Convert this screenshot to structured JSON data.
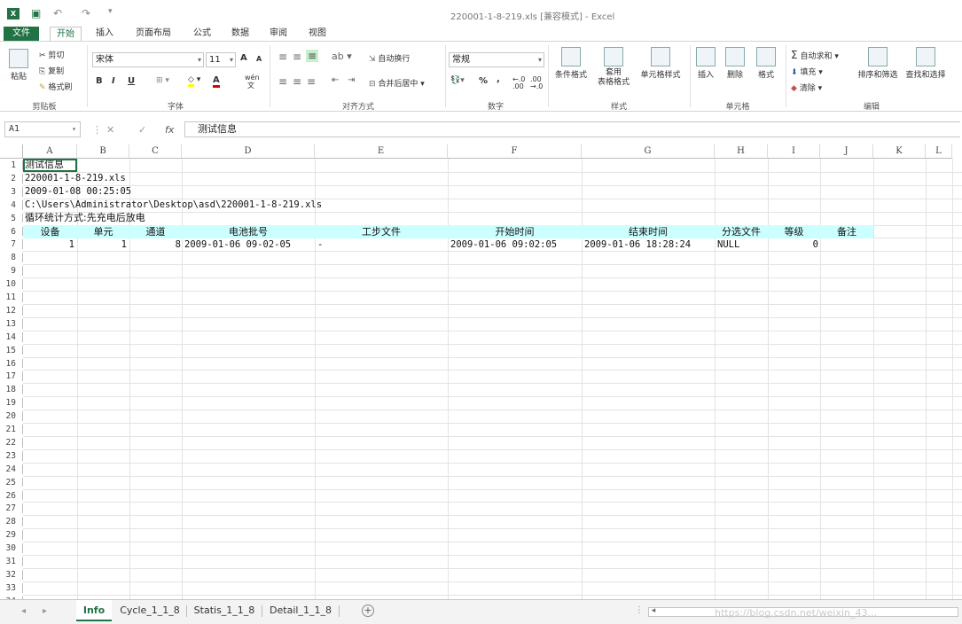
{
  "app": {
    "window_title": "220001-1-8-219.xls  [兼容模式] - Excel",
    "logo_text": "X"
  },
  "ribbon_tabs": [
    {
      "label": "文件"
    },
    {
      "label": "开始"
    },
    {
      "label": "插入"
    },
    {
      "label": "页面布局"
    },
    {
      "label": "公式"
    },
    {
      "label": "数据"
    },
    {
      "label": "审阅"
    },
    {
      "label": "视图"
    }
  ],
  "ribbon": {
    "clipboard": {
      "paste": "粘贴",
      "cut": "剪切",
      "copy": "复制",
      "format_painter": "格式刷",
      "label": "剪贴板"
    },
    "font": {
      "name": "宋体",
      "size": "11",
      "bold": "B",
      "italic": "I",
      "underline": "U",
      "label": "字体",
      "grow": "A",
      "shrink": "A",
      "font_color": "A",
      "phonetic": "wén 文"
    },
    "alignment": {
      "wrap": "自动换行",
      "merge": "合并后居中",
      "label": "对齐方式"
    },
    "number": {
      "format": "常规",
      "percent": "%",
      "comma": ",",
      "inc_decimal": "←.0 .00",
      "dec_decimal": ".00 →.0",
      "label": "数字"
    },
    "styles": {
      "conditional": "条件格式",
      "table_1": "套用",
      "table_2": "表格格式",
      "cell_styles": "单元格样式",
      "label": "样式"
    },
    "cells": {
      "insert": "插入",
      "delete": "删除",
      "format": "格式",
      "label": "单元格"
    },
    "editing": {
      "autosum": "自动求和",
      "fill": "填充",
      "clear": "清除",
      "sort": "排序和筛选",
      "find": "查找和选择",
      "label": "编辑"
    }
  },
  "formula_bar": {
    "name_box": "A1",
    "fx": "fx",
    "cancel": "✕",
    "enter": "✓",
    "formula": "测试信息"
  },
  "columns": [
    "A",
    "B",
    "C",
    "D",
    "E",
    "F",
    "G",
    "H",
    "I",
    "J",
    "K",
    "L"
  ],
  "rows": [
    "1",
    "2",
    "3",
    "4",
    "5",
    "6",
    "7",
    "8",
    "9",
    "10",
    "11",
    "12",
    "13",
    "14",
    "15",
    "16",
    "17",
    "18",
    "19",
    "20",
    "21",
    "22",
    "23",
    "24",
    "25",
    "26",
    "27",
    "28",
    "29",
    "30",
    "31",
    "32",
    "33",
    "34"
  ],
  "cells": {
    "A1": "测试信息",
    "A2": "220001-1-8-219.xls",
    "A3": "2009-01-08 00:25:05",
    "A4": "C:\\Users\\Administrator\\Desktop\\asd\\220001-1-8-219.xls",
    "A5": "循环统计方式:先充电后放电"
  },
  "header_row": [
    "设备",
    "单元",
    "通道",
    "电池批号",
    "工步文件",
    "开始时间",
    "结束时间",
    "分选文件",
    "等级",
    "备注"
  ],
  "data_row": {
    "device": "1",
    "unit": "1",
    "channel": "8",
    "batch": "2009-01-06 09-02-05",
    "step_file": "-",
    "start_time": "2009-01-06 09:02:05",
    "end_time": "2009-01-06 18:28:24",
    "sort_file": "NULL",
    "grade": "0"
  },
  "sheet_tabs": [
    {
      "label": "Info"
    },
    {
      "label": "Cycle_1_1_8"
    },
    {
      "label": "Statis_1_1_8"
    },
    {
      "label": "Detail_1_1_8"
    }
  ],
  "add_sheet": "+",
  "watermark": "https://blog.csdn.net/weixin_43..."
}
